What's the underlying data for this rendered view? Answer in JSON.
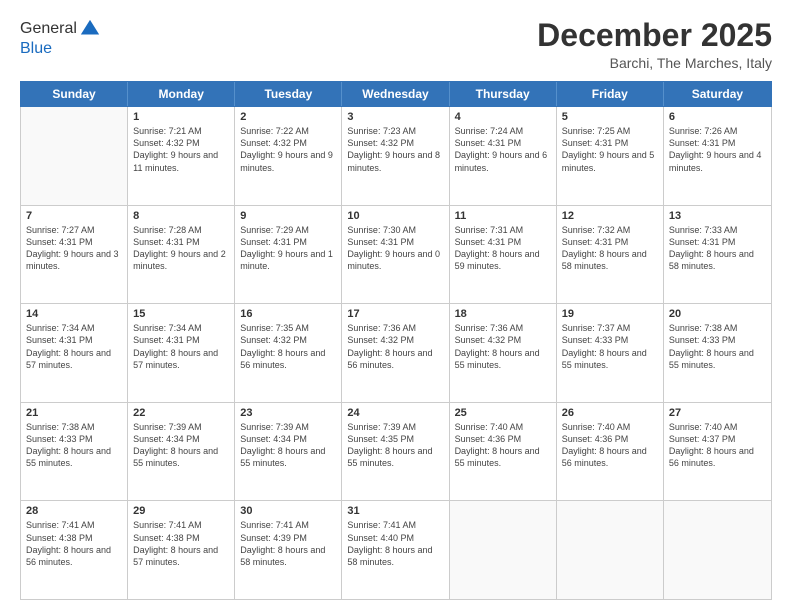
{
  "header": {
    "logo_line1": "General",
    "logo_line2": "Blue",
    "month_title": "December 2025",
    "location": "Barchi, The Marches, Italy"
  },
  "days_of_week": [
    "Sunday",
    "Monday",
    "Tuesday",
    "Wednesday",
    "Thursday",
    "Friday",
    "Saturday"
  ],
  "weeks": [
    [
      {
        "day": "",
        "empty": true
      },
      {
        "day": "1",
        "sunrise": "7:21 AM",
        "sunset": "4:32 PM",
        "daylight": "9 hours and 11 minutes."
      },
      {
        "day": "2",
        "sunrise": "7:22 AM",
        "sunset": "4:32 PM",
        "daylight": "9 hours and 9 minutes."
      },
      {
        "day": "3",
        "sunrise": "7:23 AM",
        "sunset": "4:32 PM",
        "daylight": "9 hours and 8 minutes."
      },
      {
        "day": "4",
        "sunrise": "7:24 AM",
        "sunset": "4:31 PM",
        "daylight": "9 hours and 6 minutes."
      },
      {
        "day": "5",
        "sunrise": "7:25 AM",
        "sunset": "4:31 PM",
        "daylight": "9 hours and 5 minutes."
      },
      {
        "day": "6",
        "sunrise": "7:26 AM",
        "sunset": "4:31 PM",
        "daylight": "9 hours and 4 minutes."
      }
    ],
    [
      {
        "day": "7",
        "sunrise": "7:27 AM",
        "sunset": "4:31 PM",
        "daylight": "9 hours and 3 minutes."
      },
      {
        "day": "8",
        "sunrise": "7:28 AM",
        "sunset": "4:31 PM",
        "daylight": "9 hours and 2 minutes."
      },
      {
        "day": "9",
        "sunrise": "7:29 AM",
        "sunset": "4:31 PM",
        "daylight": "9 hours and 1 minute."
      },
      {
        "day": "10",
        "sunrise": "7:30 AM",
        "sunset": "4:31 PM",
        "daylight": "9 hours and 0 minutes."
      },
      {
        "day": "11",
        "sunrise": "7:31 AM",
        "sunset": "4:31 PM",
        "daylight": "8 hours and 59 minutes."
      },
      {
        "day": "12",
        "sunrise": "7:32 AM",
        "sunset": "4:31 PM",
        "daylight": "8 hours and 58 minutes."
      },
      {
        "day": "13",
        "sunrise": "7:33 AM",
        "sunset": "4:31 PM",
        "daylight": "8 hours and 58 minutes."
      }
    ],
    [
      {
        "day": "14",
        "sunrise": "7:34 AM",
        "sunset": "4:31 PM",
        "daylight": "8 hours and 57 minutes."
      },
      {
        "day": "15",
        "sunrise": "7:34 AM",
        "sunset": "4:31 PM",
        "daylight": "8 hours and 57 minutes."
      },
      {
        "day": "16",
        "sunrise": "7:35 AM",
        "sunset": "4:32 PM",
        "daylight": "8 hours and 56 minutes."
      },
      {
        "day": "17",
        "sunrise": "7:36 AM",
        "sunset": "4:32 PM",
        "daylight": "8 hours and 56 minutes."
      },
      {
        "day": "18",
        "sunrise": "7:36 AM",
        "sunset": "4:32 PM",
        "daylight": "8 hours and 55 minutes."
      },
      {
        "day": "19",
        "sunrise": "7:37 AM",
        "sunset": "4:33 PM",
        "daylight": "8 hours and 55 minutes."
      },
      {
        "day": "20",
        "sunrise": "7:38 AM",
        "sunset": "4:33 PM",
        "daylight": "8 hours and 55 minutes."
      }
    ],
    [
      {
        "day": "21",
        "sunrise": "7:38 AM",
        "sunset": "4:33 PM",
        "daylight": "8 hours and 55 minutes."
      },
      {
        "day": "22",
        "sunrise": "7:39 AM",
        "sunset": "4:34 PM",
        "daylight": "8 hours and 55 minutes."
      },
      {
        "day": "23",
        "sunrise": "7:39 AM",
        "sunset": "4:34 PM",
        "daylight": "8 hours and 55 minutes."
      },
      {
        "day": "24",
        "sunrise": "7:39 AM",
        "sunset": "4:35 PM",
        "daylight": "8 hours and 55 minutes."
      },
      {
        "day": "25",
        "sunrise": "7:40 AM",
        "sunset": "4:36 PM",
        "daylight": "8 hours and 55 minutes."
      },
      {
        "day": "26",
        "sunrise": "7:40 AM",
        "sunset": "4:36 PM",
        "daylight": "8 hours and 56 minutes."
      },
      {
        "day": "27",
        "sunrise": "7:40 AM",
        "sunset": "4:37 PM",
        "daylight": "8 hours and 56 minutes."
      }
    ],
    [
      {
        "day": "28",
        "sunrise": "7:41 AM",
        "sunset": "4:38 PM",
        "daylight": "8 hours and 56 minutes."
      },
      {
        "day": "29",
        "sunrise": "7:41 AM",
        "sunset": "4:38 PM",
        "daylight": "8 hours and 57 minutes."
      },
      {
        "day": "30",
        "sunrise": "7:41 AM",
        "sunset": "4:39 PM",
        "daylight": "8 hours and 58 minutes."
      },
      {
        "day": "31",
        "sunrise": "7:41 AM",
        "sunset": "4:40 PM",
        "daylight": "8 hours and 58 minutes."
      },
      {
        "day": "",
        "empty": true
      },
      {
        "day": "",
        "empty": true
      },
      {
        "day": "",
        "empty": true
      }
    ]
  ]
}
